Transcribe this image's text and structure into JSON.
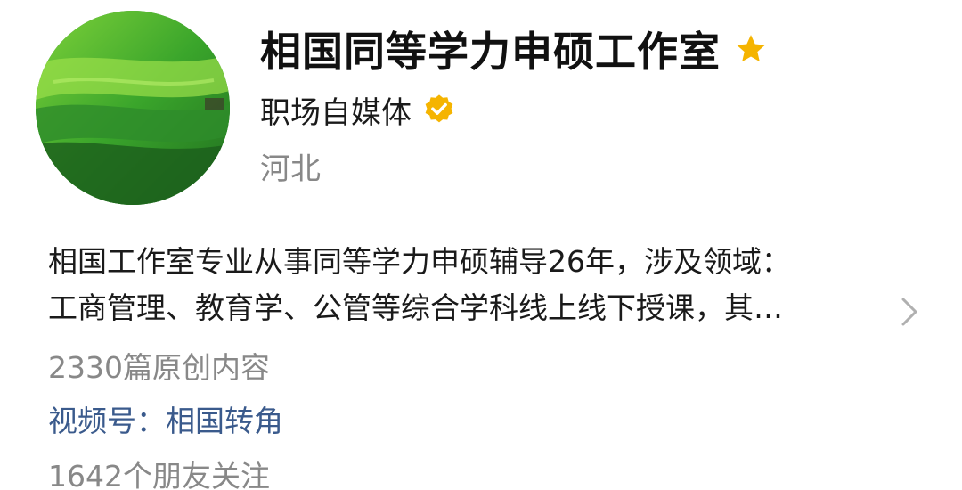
{
  "profile": {
    "name": "相国同等学力申硕工作室",
    "category": "职场自媒体",
    "location": "河北",
    "description_line1": "相国工作室专业从事同等学力申硕辅导26年，涉及领域：",
    "description_line2": "工商管理、教育学、公管等综合学科线上线下授课，其…",
    "original_count": "2330篇原创内容",
    "video_channel": "视频号：相国转角",
    "followers": "1642个朋友关注"
  },
  "icons": {
    "star": "star-icon",
    "verified": "verified-icon",
    "chevron": "chevron-right-icon"
  },
  "colors": {
    "star": "#F5B400",
    "verified": "#F5B400",
    "link": "#3A5A8C",
    "muted": "#888888"
  }
}
